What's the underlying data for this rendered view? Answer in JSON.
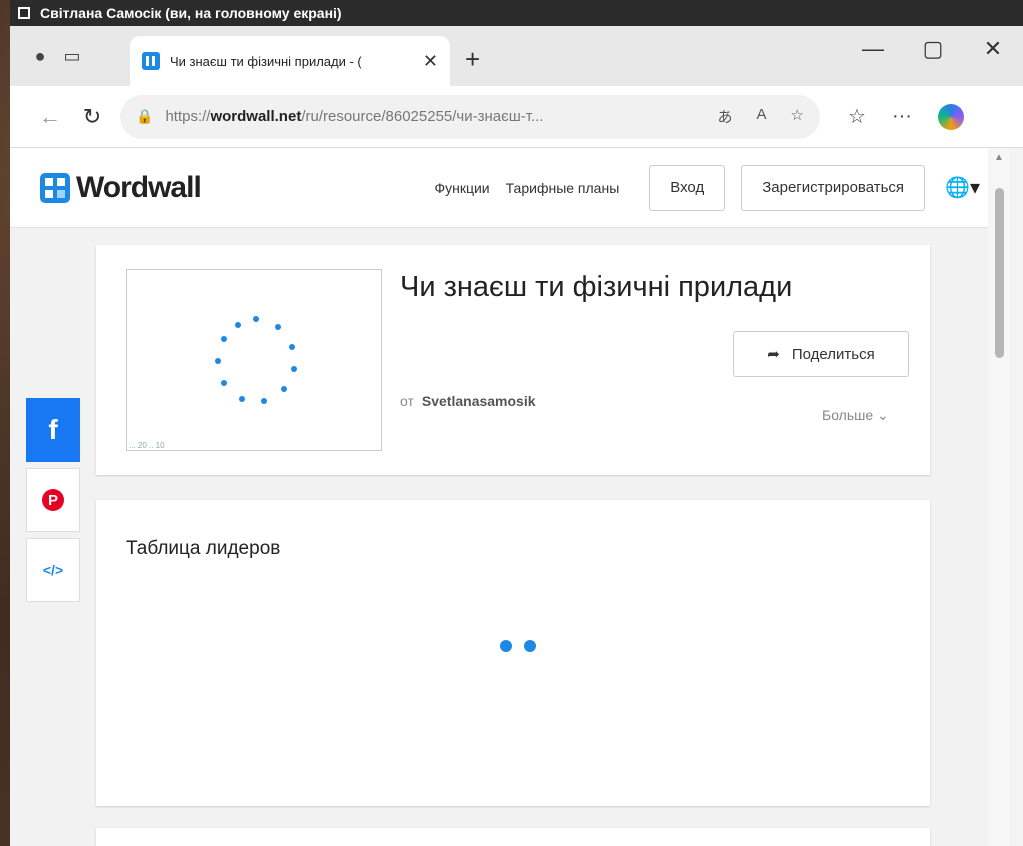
{
  "os_title": "Світлана Самосік (ви, на головному екрані)",
  "browser": {
    "tab_title": "Чи знаєш ти фізичні прилади - (",
    "new_tab": "+",
    "url_prefix": "https://",
    "url_domain": "wordwall.net",
    "url_path": "/ru/resource/86025255/чи-знаєш-т...",
    "window_controls": [
      "—",
      "▢",
      "✕"
    ]
  },
  "site": {
    "logo": "Wordwall",
    "nav": [
      "Функции",
      "Тарифные планы"
    ],
    "login": "Вход",
    "signup": "Зарегистрироваться"
  },
  "resource": {
    "title": "Чи знаєш ти фізичні прилади",
    "share": "Поделиться",
    "author_prefix": "от",
    "author": "Svetlanasamosik",
    "more": "Больше",
    "thumb_caption": "... 20 .. 10"
  },
  "leaderboard": {
    "title": "Таблица лидеров"
  },
  "colors": {
    "accent": "#1e88e5",
    "facebook": "#1877f2",
    "pinterest": "#e60023"
  }
}
